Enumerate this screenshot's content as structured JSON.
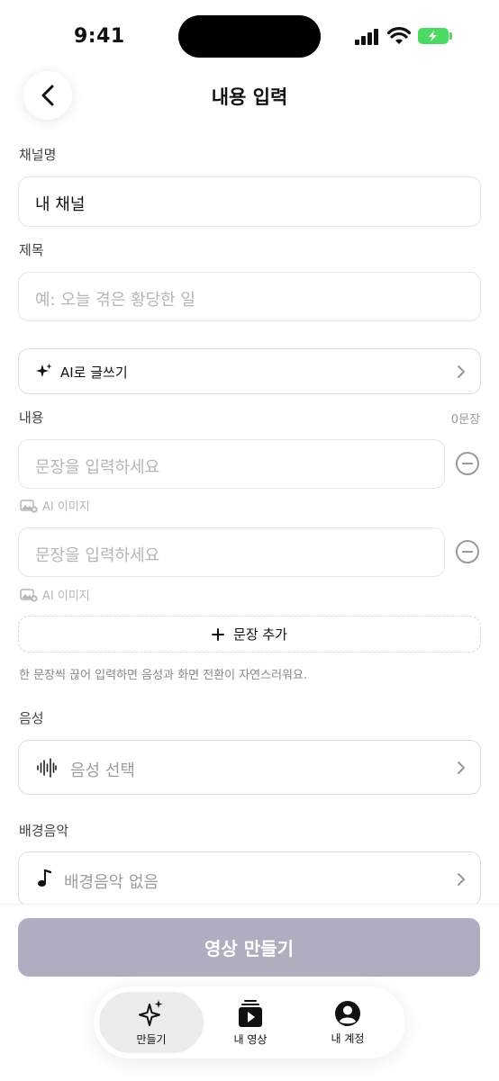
{
  "status_bar": {
    "time": "9:41"
  },
  "header": {
    "title": "내용 입력"
  },
  "channel": {
    "label": "채널명",
    "value": "내 채널"
  },
  "subject": {
    "label": "제목",
    "placeholder": "예: 오늘 겪은 황당한 일"
  },
  "ai_write": {
    "label": "AI로 글쓰기"
  },
  "content": {
    "label": "내용",
    "count": "0문장",
    "sentences": [
      {
        "placeholder": "문장을 입력하세요",
        "ai_image_label": "AI 이미지"
      },
      {
        "placeholder": "문장을 입력하세요",
        "ai_image_label": "AI 이미지"
      }
    ],
    "add_sentence_label": "문장 추가",
    "hint": "한 문장씩 끊어 입력하면 음성과 화면 전환이 자연스러워요."
  },
  "voice": {
    "label": "음성",
    "value": "음성 선택"
  },
  "bgm": {
    "label": "배경음악",
    "value": "배경음악 없음"
  },
  "make_button": {
    "label": "영상 만들기"
  },
  "tabs": [
    {
      "label": "만들기",
      "icon": "sparkle-icon",
      "active": true
    },
    {
      "label": "내 영상",
      "icon": "video-library-icon",
      "active": false
    },
    {
      "label": "내 계정",
      "icon": "account-icon",
      "active": false
    }
  ],
  "colors": {
    "accent_disabled": "#aeaec0",
    "battery": "#4cd964",
    "border": "#e6e6ea"
  }
}
